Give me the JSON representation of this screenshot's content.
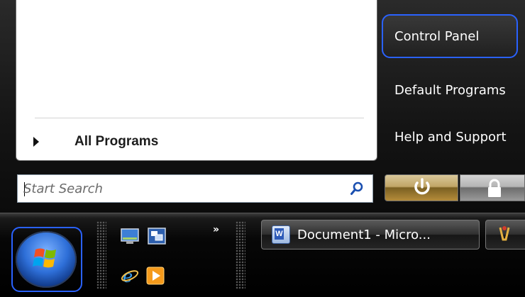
{
  "start_menu": {
    "all_programs_label": "All Programs",
    "search": {
      "placeholder": "Start Search"
    },
    "right_pane": {
      "items": [
        {
          "label": "Control Panel",
          "highlighted": true
        },
        {
          "label": "Default Programs"
        },
        {
          "label": "Help and Support"
        }
      ]
    },
    "power_icon": "power-icon",
    "lock_icon": "lock-icon"
  },
  "taskbar": {
    "start_button_icon": "windows-logo-icon",
    "quick_launch_icons": [
      "show-desktop-icon",
      "switch-windows-icon",
      "internet-explorer-icon",
      "media-player-icon"
    ],
    "more_label": "»",
    "buttons": [
      {
        "label": "Document1 - Micro...",
        "icon": "word-document-icon"
      },
      {
        "label": "",
        "icon": "paint-icon"
      }
    ]
  },
  "colors": {
    "highlight_border": "#2a62ff",
    "taskbar_bg": "#000000",
    "menu_left_bg": "#ffffff"
  }
}
